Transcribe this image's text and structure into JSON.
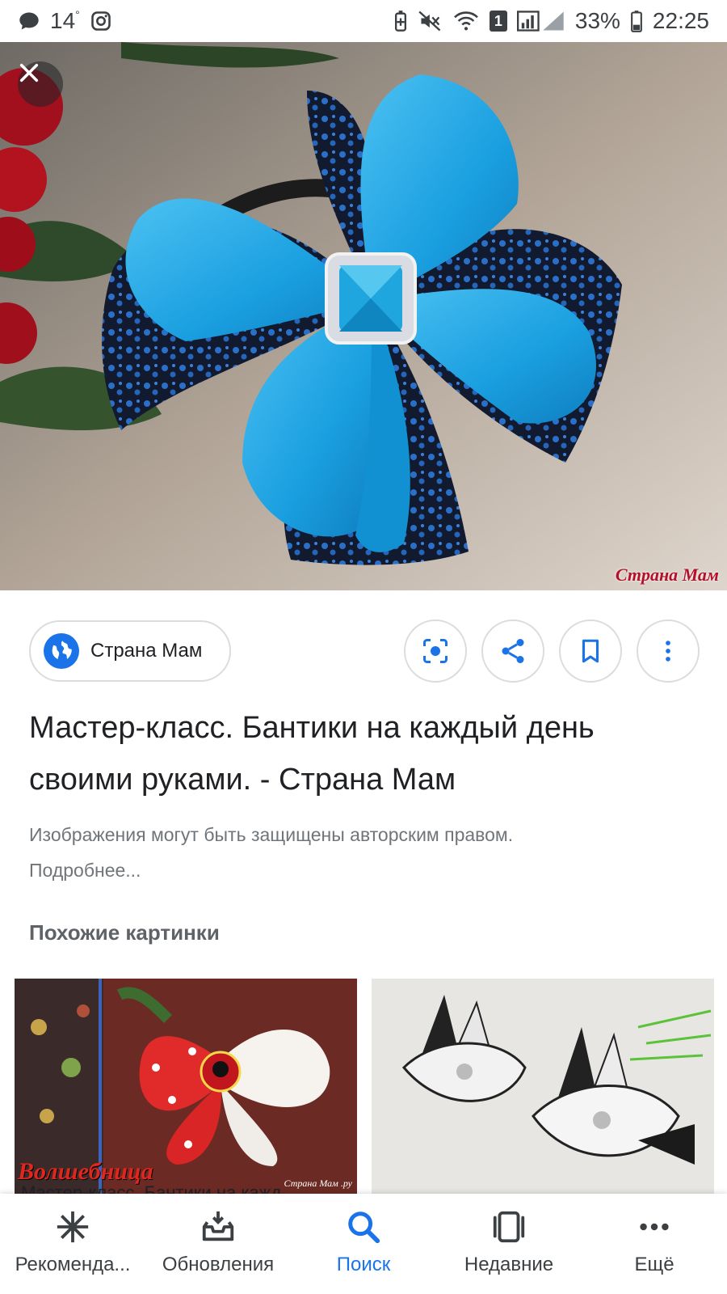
{
  "status_bar": {
    "temperature": "14",
    "battery": "33%",
    "time": "22:25",
    "sim_badge": "1",
    "icons": [
      "message-icon",
      "instagram-icon",
      "battery-saver-icon",
      "mute-icon",
      "wifi-icon",
      "signal-icon",
      "battery-icon"
    ]
  },
  "hero": {
    "watermark": "Страна Мам"
  },
  "source": {
    "name": "Страна Мам"
  },
  "actions": [
    "lens-icon",
    "share-icon",
    "bookmark-icon",
    "more-vert-icon"
  ],
  "result": {
    "title": "Мастер-класс. Бантики на каждый день своими руками. - Страна Мам",
    "copyright": "Изображения могут быть защищены авторским правом.",
    "more_link": "Подробнее..."
  },
  "similar": {
    "heading": "Похожие картинки",
    "items": [
      {
        "caption": "Мастер-класс. Бантики на кажд",
        "overlay_text": "Волшебница",
        "small_text": "Страна Мам .ру"
      },
      {
        "caption": ""
      }
    ]
  },
  "bottom_nav": [
    {
      "label": "Рекоменда...",
      "icon": "asterisk-icon",
      "active": false
    },
    {
      "label": "Обновления",
      "icon": "inbox-icon",
      "active": false
    },
    {
      "label": "Поиск",
      "icon": "search-icon",
      "active": true
    },
    {
      "label": "Недавние",
      "icon": "tabs-icon",
      "active": false
    },
    {
      "label": "Ещё",
      "icon": "more-horiz-icon",
      "active": false
    }
  ],
  "colors": {
    "accent": "#1a73e8",
    "text_primary": "#202124",
    "text_secondary": "#70757a",
    "border": "#dadce0"
  }
}
